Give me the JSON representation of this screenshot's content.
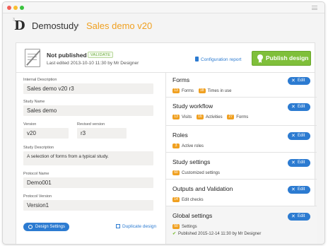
{
  "titlebar": {
    "menu_icon": "hamburger-icon"
  },
  "header": {
    "logo": "D",
    "logo_sup": "3",
    "breadcrumb_root": "Demostudy",
    "breadcrumb_sep": "›",
    "breadcrumb_current": "Sales demo v20"
  },
  "colors": {
    "accent_blue": "#2c7bd1",
    "accent_orange": "#f0a020",
    "publish_green": "#7fbf3a"
  },
  "status": {
    "title": "Not published",
    "validate_label": "VALIDATE",
    "last_edited": "Last edited 2013-10-10 11:30 by Mr Designer",
    "config_report": "Configuration report",
    "publish_label": "Publish design"
  },
  "form": {
    "internal_description": {
      "label": "Internal Description",
      "value": "Sales demo v20 r3"
    },
    "study_name": {
      "label": "Study Name",
      "value": "Sales demo"
    },
    "version": {
      "label": "Version",
      "value": "v20"
    },
    "revised_version": {
      "label": "Revised version",
      "value": "r3"
    },
    "study_description": {
      "label": "Study Description",
      "value": "A selection of forms from a typical study."
    },
    "protocol_name": {
      "label": "Protocol Name",
      "value": "Demo001"
    },
    "protocol_version": {
      "label": "Protocol Version",
      "value": "Version1"
    },
    "design_settings_label": "Design Settings",
    "duplicate_label": "Duplicate design"
  },
  "sections": {
    "edit_label": "Edit",
    "forms": {
      "title": "Forms",
      "stats": [
        {
          "count": "13",
          "label": "Forms"
        },
        {
          "count": "18",
          "label": "Times in use"
        }
      ]
    },
    "workflow": {
      "title": "Study workflow",
      "stats": [
        {
          "count": "13",
          "label": "Visits"
        },
        {
          "count": "16",
          "label": "Activities"
        },
        {
          "count": "27",
          "label": "Forms"
        }
      ]
    },
    "roles": {
      "title": "Roles",
      "stats": [
        {
          "count": "3",
          "label": "Active roles"
        }
      ]
    },
    "study_settings": {
      "title": "Study settings",
      "stats": [
        {
          "count": "60",
          "label": "Customized settings"
        }
      ]
    },
    "outputs": {
      "title": "Outputs and Validation",
      "stats": [
        {
          "count": "14",
          "label": "Edit checks"
        }
      ]
    },
    "global": {
      "title": "Global settings",
      "stats": [
        {
          "count": "50",
          "label": "Settings"
        }
      ],
      "published": "Published 2015-12-14 11:30 by Mr Designer"
    }
  }
}
